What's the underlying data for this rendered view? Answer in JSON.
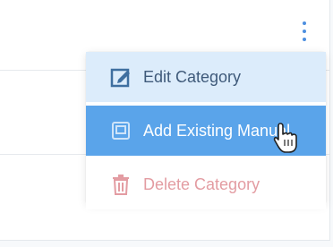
{
  "menu": {
    "items": [
      {
        "label": "Edit Category",
        "icon": "edit-icon"
      },
      {
        "label": "Add Existing Manual",
        "icon": "add-manual-icon"
      },
      {
        "label": "Delete Category",
        "icon": "trash-icon"
      }
    ],
    "colors": {
      "edit_bg": "#dcecfb",
      "add_bg": "#5aa4ea",
      "delete_text": "#e39ca2",
      "kebab": "#4d8fe0"
    }
  },
  "kebab_icon": "more-vertical-icon",
  "cursor_icon": "hand-pointer-icon"
}
